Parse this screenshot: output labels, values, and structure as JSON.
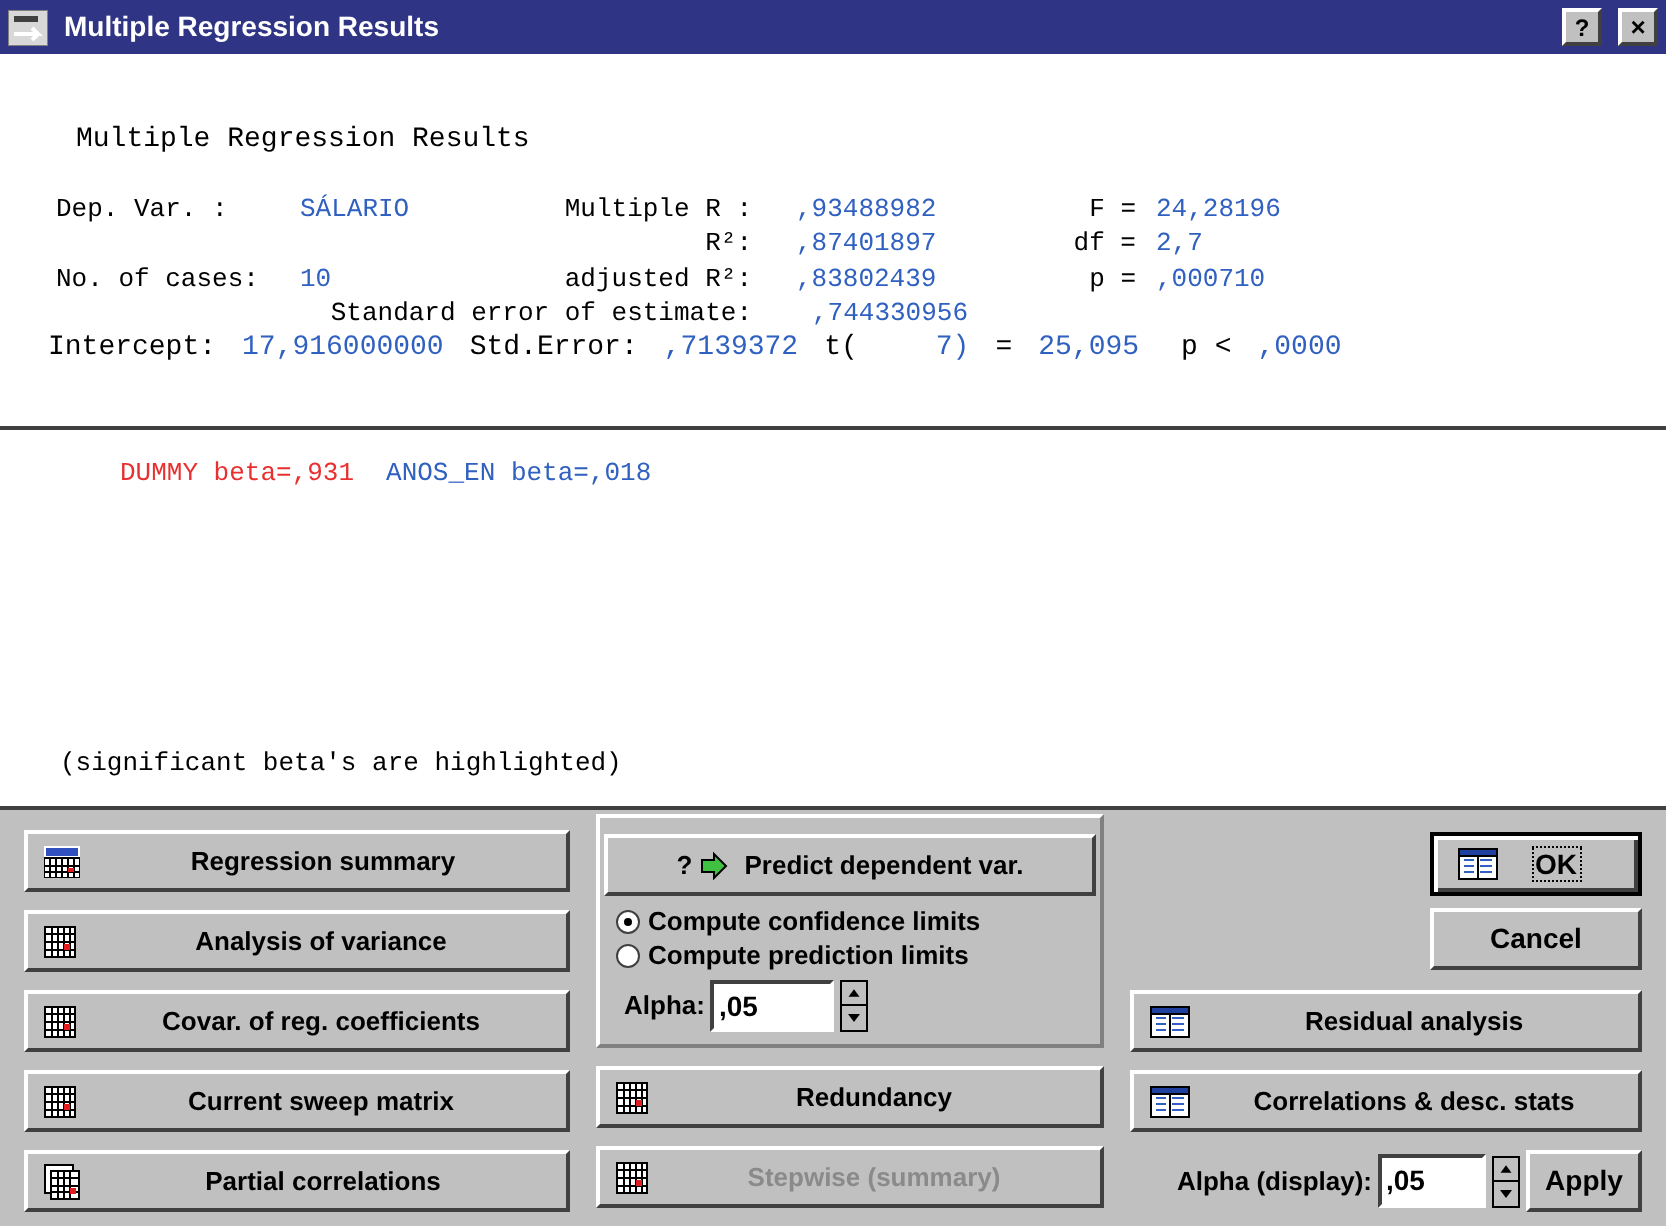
{
  "window": {
    "title": "Multiple Regression Results",
    "help_button": "?",
    "close_button": "×"
  },
  "results": {
    "heading": "Multiple Regression Results",
    "stat_lines": [
      {
        "label_1": "Dep. Var. :",
        "value_1": "SÁLARIO",
        "label_2": "Multiple R :",
        "value_2": ",93488982",
        "label_3": "F =",
        "value_3": "24,28196"
      },
      {
        "label_2": "R²:",
        "value_2": ",87401897",
        "label_3": "df =",
        "value_3": "2,7"
      },
      {
        "label_1": "No. of cases:",
        "value_1": "10",
        "label_2": "adjusted R²:",
        "value_2": ",83802439",
        "label_3": "p =",
        "value_3": ",000710"
      }
    ],
    "stderr": {
      "label": "Standard error of estimate:",
      "value": ",744330956"
    },
    "intercept": [
      {
        "kind": "label",
        "text": "Intercept:"
      },
      {
        "kind": "value",
        "text": "17,916000000"
      },
      {
        "kind": "label",
        "text": "Std.Error:"
      },
      {
        "kind": "value",
        "text": ",7139372"
      },
      {
        "kind": "label",
        "text": "t("
      },
      {
        "kind": "value",
        "text": "7)"
      },
      {
        "kind": "label",
        "text": "="
      },
      {
        "kind": "value",
        "text": "25,095"
      },
      {
        "kind": "label",
        "text": "p <"
      },
      {
        "kind": "value",
        "text": ",0000"
      }
    ]
  },
  "betas": [
    {
      "text": "DUMMY beta=,931",
      "significant": true
    },
    {
      "text": "ANOS_EN beta=,018",
      "significant": false
    }
  ],
  "beta_note": "(significant beta's are highlighted)",
  "left_buttons": [
    {
      "label": "Regression summary",
      "kind": "summary",
      "disabled": false
    },
    {
      "label": "Analysis of variance",
      "kind": "grid",
      "disabled": false
    },
    {
      "label": "Covar. of reg. coefficients",
      "kind": "grid",
      "disabled": false
    },
    {
      "label": "Current sweep matrix",
      "kind": "grid",
      "disabled": false
    },
    {
      "label": "Partial correlations",
      "kind": "stack",
      "disabled": false
    }
  ],
  "predict": {
    "button": "Predict dependent var.",
    "button_icon": "?",
    "options": [
      {
        "label": "Compute confidence limits",
        "selected": true
      },
      {
        "label": "Compute prediction limits",
        "selected": false
      }
    ],
    "alpha_label": "Alpha:",
    "alpha_value": ",05"
  },
  "middle_buttons": [
    {
      "label": "Redundancy",
      "kind": "grid",
      "disabled": false
    },
    {
      "label": "Stepwise (summary)",
      "kind": "grid",
      "disabled": true
    }
  ],
  "ok_button": "OK",
  "cancel_button": "Cancel",
  "right_buttons": [
    {
      "label": "Residual analysis",
      "kind": "table",
      "disabled": false
    },
    {
      "label": "Correlations & desc. stats",
      "kind": "table",
      "disabled": false
    }
  ],
  "alpha_display": {
    "label": "Alpha (display):",
    "value": ",05",
    "apply": "Apply"
  }
}
